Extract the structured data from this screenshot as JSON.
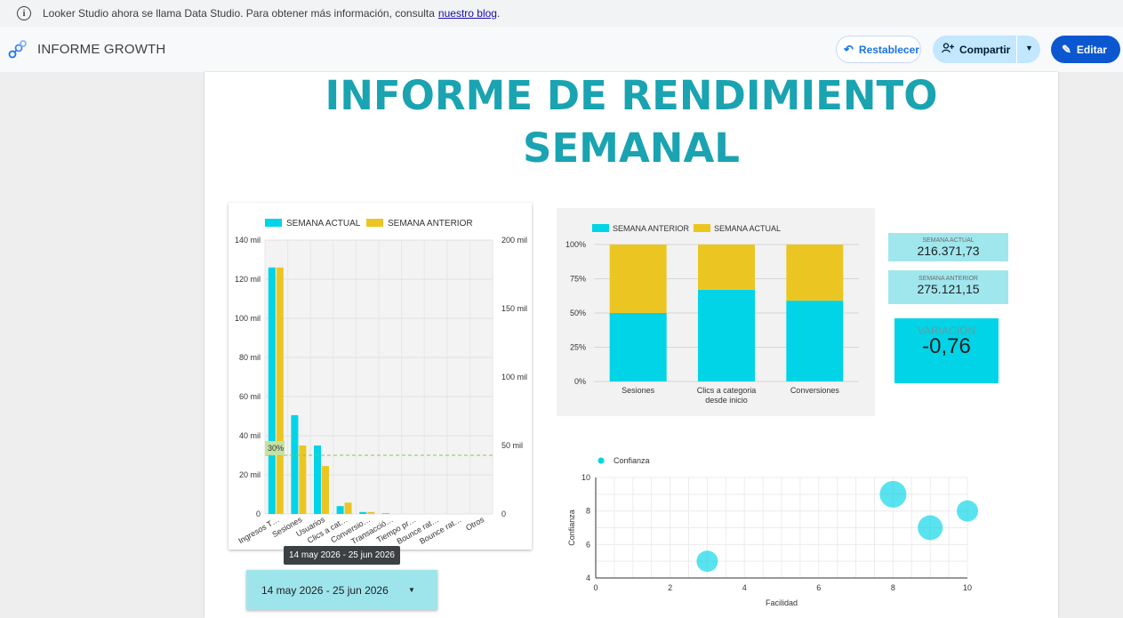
{
  "notice": {
    "text": "Looker Studio ahora se llama Data Studio. Para obtener más información, consulta",
    "link": "nuestro blog",
    "tail": "."
  },
  "header": {
    "title": "INFORME GROWTH",
    "reset_label": "Restablecer",
    "share_label": "Compartir",
    "edit_label": "Editar"
  },
  "report": {
    "title_line1": "INFORME DE RENDIMIENTO",
    "title_line2": "SEMANAL"
  },
  "kpis": {
    "current_label": "SEMANA ACTUAL",
    "current_value": "216.371,73",
    "previous_label": "SEMANA ANTERIOR",
    "previous_value": "275.121,15",
    "variation_label": "VARIACIÓN",
    "variation_value": "-0,76"
  },
  "date_range": {
    "tooltip": "14 may 2026 - 25 jun 2026",
    "value": "14 may 2026 - 25 jun 2026"
  },
  "colors": {
    "cyan": "#00d4e6",
    "yellow": "#ebc622",
    "title_teal": "#1aa3b1",
    "accent_blue": "#0b57d0"
  },
  "chart_data": [
    {
      "type": "bar",
      "legend_position": "top",
      "categories": [
        "Ingresos T…",
        "Sesiones",
        "Usuarios",
        "Clics a cat…",
        "Conversio…",
        "Transacció…",
        "Tiempo pr…",
        "Bounce rat…",
        "Bounce rat…",
        "Otros"
      ],
      "series": [
        {
          "name": "SEMANA ACTUAL",
          "values": [
            126000,
            50500,
            35000,
            4000,
            1000,
            300,
            0,
            0,
            0,
            0
          ]
        },
        {
          "name": "SEMANA ANTERIOR",
          "values": [
            126000,
            35000,
            24500,
            5800,
            1000,
            0,
            0,
            0,
            0,
            0
          ]
        }
      ],
      "y_left_ticks": [
        "0",
        "20 mil",
        "40 mil",
        "60 mil",
        "80 mil",
        "100 mil",
        "120 mil",
        "140 mil"
      ],
      "y_right_ticks": [
        "0",
        "50 mil",
        "100 mil",
        "150 mil",
        "200 mil"
      ],
      "ylim": [
        0,
        140000
      ],
      "reference_line": {
        "label": "30%",
        "value": 30000
      },
      "grid": true
    },
    {
      "type": "bar",
      "stacked": "percent",
      "legend_position": "top",
      "categories": [
        "Sesiones",
        "Clics a categoria desde inicio",
        "Conversiones"
      ],
      "series": [
        {
          "name": "SEMANA ANTERIOR",
          "values": [
            50,
            67,
            59
          ]
        },
        {
          "name": "SEMANA ACTUAL",
          "values": [
            50,
            33,
            41
          ]
        }
      ],
      "y_ticks": [
        "0%",
        "25%",
        "50%",
        "75%",
        "100%"
      ],
      "ylim": [
        0,
        100
      ],
      "grid": true
    },
    {
      "type": "scatter",
      "legend_position": "top-left",
      "series": [
        {
          "name": "Confianza",
          "points": [
            {
              "x": 3,
              "y": 5
            },
            {
              "x": 8,
              "y": 9
            },
            {
              "x": 9,
              "y": 7
            },
            {
              "x": 10,
              "y": 8
            }
          ]
        }
      ],
      "xlabel": "Facilidad",
      "ylabel": "Confianza",
      "xlim": [
        0,
        10
      ],
      "ylim": [
        4,
        10
      ],
      "x_ticks": [
        0,
        2,
        4,
        6,
        8,
        10
      ],
      "y_ticks": [
        4,
        6,
        8,
        10
      ],
      "grid": true
    }
  ]
}
